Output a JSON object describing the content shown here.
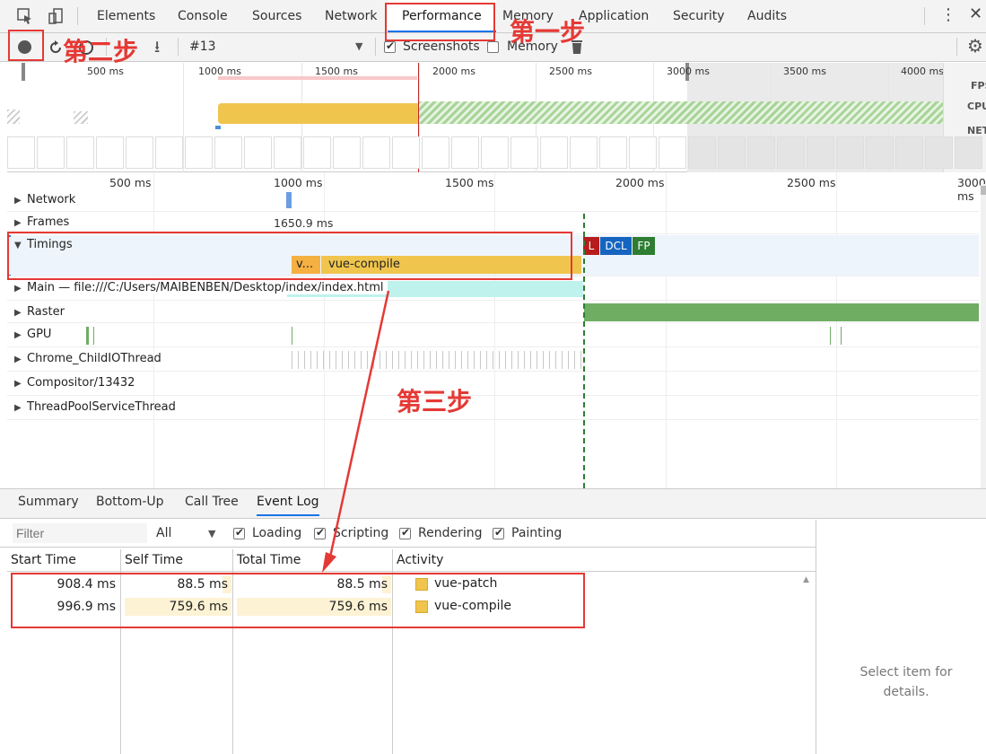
{
  "devtools_tabs": [
    "Elements",
    "Console",
    "Sources",
    "Network",
    "Performance",
    "Memory",
    "Application",
    "Security",
    "Audits"
  ],
  "toolbar": {
    "recording_select": "#13",
    "screenshots_label": "Screenshots",
    "memory_label": "Memory"
  },
  "overview": {
    "ticks": [
      "500 ms",
      "1000 ms",
      "1500 ms",
      "2000 ms",
      "2500 ms",
      "3000 ms",
      "3500 ms",
      "4000 ms"
    ],
    "side_labels": [
      "FPS",
      "CPU",
      "NET"
    ]
  },
  "flame": {
    "ticks": [
      "500 ms",
      "1000 ms",
      "1500 ms",
      "2000 ms",
      "2500 ms",
      "3000 ms"
    ],
    "frames_value": "1650.9 ms",
    "tracks": [
      "Network",
      "Frames",
      "Timings",
      "Main — file:///C:/Users/MAIBENBEN/Desktop/index/index.html",
      "Raster",
      "GPU",
      "Chrome_ChildIOThread",
      "Compositor/13432",
      "ThreadPoolServiceThread"
    ],
    "timing_short": "v...",
    "timing_long": "vue-compile",
    "markers": [
      "L",
      "DCL",
      "FP"
    ],
    "marker_colors": [
      "#b71c1c",
      "#1565c0",
      "#2e7d32"
    ]
  },
  "bottom_tabs": [
    "Summary",
    "Bottom-Up",
    "Call Tree",
    "Event Log"
  ],
  "filter": {
    "placeholder": "Filter",
    "all_label": "All",
    "checks": [
      "Loading",
      "Scripting",
      "Rendering",
      "Painting"
    ]
  },
  "table": {
    "headers": [
      "Start Time",
      "Self Time",
      "Total Time",
      "Activity"
    ],
    "rows": [
      {
        "start": "908.4 ms",
        "self": "88.5 ms",
        "total": "88.5 ms",
        "activity": "vue-patch"
      },
      {
        "start": "996.9 ms",
        "self": "759.6 ms",
        "total": "759.6 ms",
        "activity": "vue-compile"
      }
    ]
  },
  "details_placeholder": "Select item for details.",
  "annotations": {
    "step1": "第一步",
    "step2": "第二步",
    "step3": "第三步"
  },
  "colors": {
    "accent": "#1a73e8",
    "annotation_red": "#e53935",
    "cpu_yellow": "#f0c54e",
    "raster_green": "#6fad63",
    "main_cyan": "#bff2ec"
  }
}
